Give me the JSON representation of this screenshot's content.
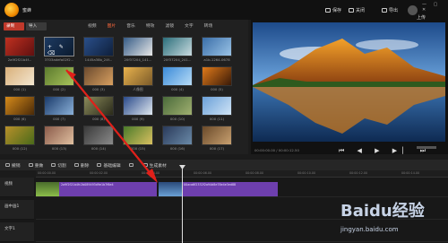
{
  "app": {
    "title": "蜜蜂"
  },
  "topbar": {
    "save": "保存",
    "close": "关闭",
    "export": "导出",
    "upload": "上传",
    "window_controls": "— ▢ ✕"
  },
  "media": {
    "record_label": "录制",
    "import_label": "导入",
    "tabs": [
      "视频",
      "图片",
      "音乐",
      "特效",
      "滤镜",
      "文字",
      "转场"
    ],
    "active_tab": 1,
    "items": [
      {
        "caption": "2a9f2f21b4f...",
        "colors": [
          "#c03020",
          "#601010"
        ]
      },
      {
        "caption": "3703adefa02f2...",
        "colors": [
          "#1d3a62",
          "#0b1b2f"
        ],
        "selected": true
      },
      {
        "caption": "1445a38b_24f...",
        "colors": [
          "#2a4f8a",
          "#0e1f3b"
        ]
      },
      {
        "caption": "20f37204_141...",
        "colors": [
          "#355b86",
          "#e8e8e8"
        ]
      },
      {
        "caption": "20f37204_241...",
        "colors": [
          "#2b6e7a",
          "#c9dbe0"
        ]
      },
      {
        "caption": "a1b-1264-0678",
        "colors": [
          "#3a6ea8",
          "#9ac3e6"
        ]
      },
      {
        "caption": "000 (1)",
        "colors": [
          "#d9b07a",
          "#f3e6d0"
        ]
      },
      {
        "caption": "000 (2)",
        "colors": [
          "#5c7a2e",
          "#a8c35a"
        ]
      },
      {
        "caption": "000 (3)",
        "colors": [
          "#6b4a2e",
          "#d8a060"
        ]
      },
      {
        "caption": "人像图",
        "colors": [
          "#e9b24c",
          "#7a5a2a"
        ]
      },
      {
        "caption": "000 (4)",
        "colors": [
          "#3a8ad8",
          "#b7dcf6"
        ]
      },
      {
        "caption": "000 (5)",
        "colors": [
          "#e07a1a",
          "#3a1a08"
        ]
      },
      {
        "caption": "000 (6)",
        "colors": [
          "#d58a1a",
          "#4a2a08"
        ]
      },
      {
        "caption": "000 (7)",
        "colors": [
          "#1a3a6a",
          "#8ab0d8"
        ]
      },
      {
        "caption": "000 (8)",
        "colors": [
          "#8a8a5a",
          "#2a2a1a"
        ]
      },
      {
        "caption": "000 (9)",
        "colors": [
          "#2a4a8a",
          "#e0e8f0"
        ]
      },
      {
        "caption": "000 (10)",
        "colors": [
          "#4a6a3a",
          "#a0b070"
        ]
      },
      {
        "caption": "000 (11)",
        "colors": [
          "#6aa0d8",
          "#d0e4f6"
        ]
      },
      {
        "caption": "000 (12)",
        "colors": [
          "#b8902a",
          "#4a6a1a"
        ]
      },
      {
        "caption": "000 (13)",
        "colors": [
          "#8a5a4a",
          "#e0c0a0"
        ]
      },
      {
        "caption": "000 (14)",
        "colors": [
          "#3a3a3a",
          "#8a8a8a"
        ]
      },
      {
        "caption": "000 (15)",
        "colors": [
          "#4a7a2a",
          "#d8c060"
        ]
      },
      {
        "caption": "000 (16)",
        "colors": [
          "#2a3a5a",
          "#6a8aa8"
        ]
      },
      {
        "caption": "000 (17)",
        "colors": [
          "#6a4a2a",
          "#c8a070"
        ]
      }
    ]
  },
  "preview": {
    "time": "00:00:00.00 / 00:00:12.50",
    "controls": "⏮ ◀ ▶ ▶▏ ⏭"
  },
  "toolbar": {
    "items": [
      "撤销",
      "重做",
      "切割",
      "删除",
      "基础编辑",
      "",
      "生成素材"
    ]
  },
  "timeline": {
    "ticks": [
      "00:00:00.00",
      "00:00:02.00",
      "00:00:04.00",
      "00:00:06.00",
      "00:00:08.00",
      "00:00:10.00",
      "00:00:12.00",
      "00:00:14.00"
    ],
    "tracks": [
      "视频",
      "画中画1",
      "文字1"
    ],
    "clip1_label": "2a9f2f21b4fc2b089493d9e1b7f6e4",
    "clip2_label": "00aca6f2332f2a94d8e78e4e3ed88"
  },
  "watermark": {
    "logo": "Baidu经验",
    "url": "jingyan.baidu.com"
  },
  "colors": {
    "accent": "#ff6a3d",
    "clip": "#6e3fae",
    "record": "#c0392b"
  }
}
